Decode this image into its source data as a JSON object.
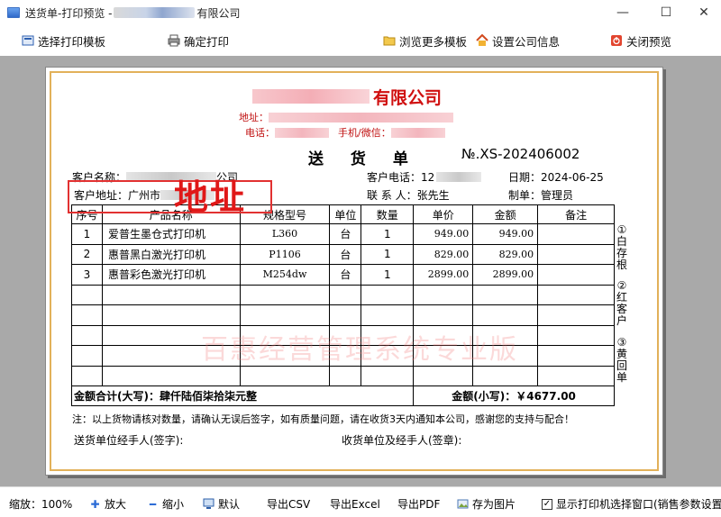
{
  "window": {
    "title_prefix": "送货单-打印预览 -",
    "title_suffix": "有限公司",
    "minimize": "—",
    "maximize": "☐",
    "close": "✕"
  },
  "toolbar": {
    "select_template": "选择打印模板",
    "confirm_print": "确定打印",
    "browse_templates": "浏览更多模板",
    "company_settings": "设置公司信息",
    "close_preview": "关闭预览"
  },
  "document": {
    "company_suffix": "有限公司",
    "address_label": "地址：",
    "phone_label": "电话：",
    "mobile_label": "手机/微信：",
    "title": "送 货 单",
    "number": "№.XS-202406002",
    "customer_name_label": "客户名称：",
    "customer_name_suffix": "公司",
    "customer_phone_label": "客户电话：",
    "customer_phone_prefix": "12",
    "date_label": "日期：",
    "date": "2024-06-25",
    "customer_address_label": "客户地址：",
    "customer_address": "广州市",
    "address_annotation": "地址",
    "contact_label": "联 系 人：",
    "contact": "张先生",
    "maker_label": "制单：",
    "maker": "管理员",
    "columns": [
      "序号",
      "产品名称",
      "规格型号",
      "单位",
      "数量",
      "单价",
      "金额",
      "备注"
    ],
    "rows": [
      {
        "no": "1",
        "name": "爱普生墨仓式打印机",
        "model": "L360",
        "unit": "台",
        "qty": "1",
        "price": "949.00",
        "amount": "949.00",
        "note": ""
      },
      {
        "no": "2",
        "name": "惠普黑白激光打印机",
        "model": "P1106",
        "unit": "台",
        "qty": "1",
        "price": "829.00",
        "amount": "829.00",
        "note": ""
      },
      {
        "no": "3",
        "name": "惠普彩色激光打印机",
        "model": "M254dw",
        "unit": "台",
        "qty": "1",
        "price": "2899.00",
        "amount": "2899.00",
        "note": ""
      }
    ],
    "total_upper_label": "金额合计(大写)：",
    "total_upper": "肆仟陆佰柒拾柒元整",
    "total_lower_label": "金额(小写)：",
    "total_lower": "￥4677.00",
    "side_note_1": "①白存根",
    "side_note_2": "②红客户",
    "side_note_3": "③黄回单",
    "watermark": "百惠经营管理系统专业版",
    "footnote": "注：以上货物请核对数量，请确认无误后签字，如有质量问题，请在收货3天内通知本公司，感谢您的支持与配合！",
    "sender_sign": "送货单位经手人(签字):",
    "receiver_sign": "收货单位及经手人(签章):"
  },
  "statusbar": {
    "zoom_label": "缩放：100%",
    "zoom_in": "放大",
    "zoom_out": "缩小",
    "default": "默认",
    "export_csv": "导出CSV",
    "export_excel": "导出Excel",
    "export_pdf": "导出PDF",
    "save_image": "存为图片",
    "show_printer_window": "显示打印机选择窗口(销售参数设置)"
  }
}
